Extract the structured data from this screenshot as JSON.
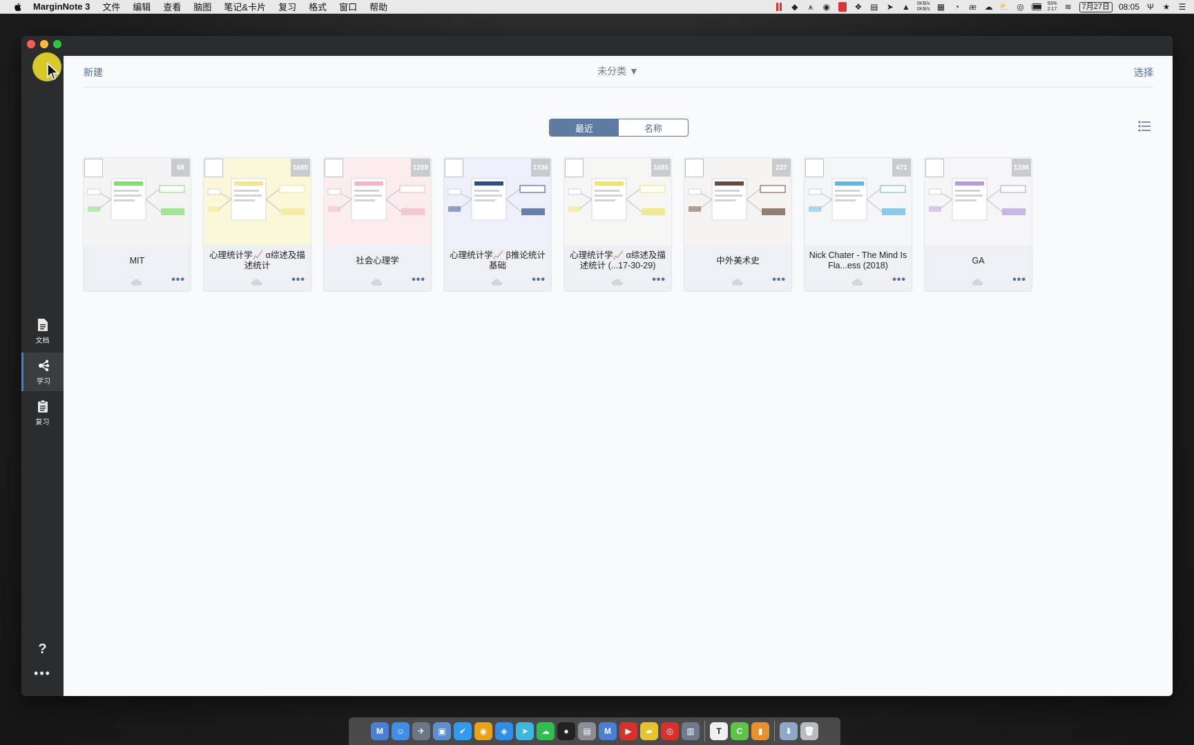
{
  "menubar": {
    "app_name": "MarginNote 3",
    "menus": [
      "文件",
      "编辑",
      "查看",
      "脑图",
      "笔记&卡片",
      "复习",
      "格式",
      "窗口",
      "帮助"
    ],
    "net_up": "0KB/s",
    "net_down": "0KB/s",
    "battery_pct": "93%",
    "battery_time": "2:17",
    "date": "7月27日",
    "time": "08:05"
  },
  "toolbar": {
    "new_label": "新建",
    "category_label": "未分类 ▼",
    "select_label": "选择"
  },
  "sort": {
    "tabs": [
      {
        "label": "最近",
        "active": true
      },
      {
        "label": "名称",
        "active": false
      }
    ]
  },
  "sidebar": {
    "items": [
      {
        "label": "文档",
        "icon": "document-icon",
        "active": false
      },
      {
        "label": "学习",
        "icon": "mindmap-icon",
        "active": true
      },
      {
        "label": "复习",
        "icon": "clipboard-icon",
        "active": false
      }
    ],
    "help_label": "?",
    "more_label": "•••"
  },
  "notebooks": [
    {
      "title": "MIT",
      "count": "68",
      "tint": "#f4f4f4",
      "accent": "#7ee06a"
    },
    {
      "title": "心理统计学📈 α综述及描述统计",
      "count": "1685",
      "tint": "#fbf8d9",
      "accent": "#f2e58a"
    },
    {
      "title": "社会心理学",
      "count": "1299",
      "tint": "#fbeced",
      "accent": "#f2b7bf"
    },
    {
      "title": "心理统计学📈 β推论统计基础",
      "count": "1336",
      "tint": "#edf0fb",
      "accent": "#2e4d8f"
    },
    {
      "title": "心理统计学📈 α综述及描述统计 (...17-30-29)",
      "count": "1685",
      "tint": "#f6f6f4",
      "accent": "#f0e36a"
    },
    {
      "title": "中外美术史",
      "count": "237",
      "tint": "#f5f4f2",
      "accent": "#6b4a3a"
    },
    {
      "title": "Nick Chater - The Mind Is Fla...ess (2018)",
      "count": "471",
      "tint": "#f5f6f8",
      "accent": "#5eb5e8"
    },
    {
      "title": "GA",
      "count": "1398",
      "tint": "#f6f5f8",
      "accent": "#b79be0"
    }
  ]
}
